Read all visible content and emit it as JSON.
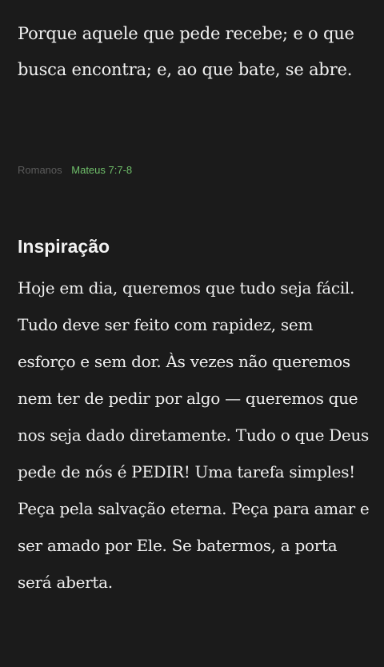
{
  "verse": {
    "text": "Porque aquele que pede recebe; e o que busca encontra; e, ao que bate, se abre."
  },
  "reference": {
    "version": "Romanos",
    "citation": "Mateus 7:7-8"
  },
  "inspiration": {
    "title": "Inspiração",
    "body": "Hoje em dia, queremos que tudo seja fácil. Tudo deve ser feito com rapidez, sem esforço e sem dor. Às vezes não queremos nem ter de pedir por algo — queremos que nos seja dado diretamente. Tudo o que Deus pede de nós é PEDIR! Uma tarefa simples! Peça pela salvação eterna. Peça para amar e ser amado por Ele. Se batermos, a porta será aberta."
  },
  "colors": {
    "background": "#1b1b1b",
    "text": "#f0f0f0",
    "reference_link": "#6fbf6a",
    "reference_version": "#5b5b5b"
  }
}
